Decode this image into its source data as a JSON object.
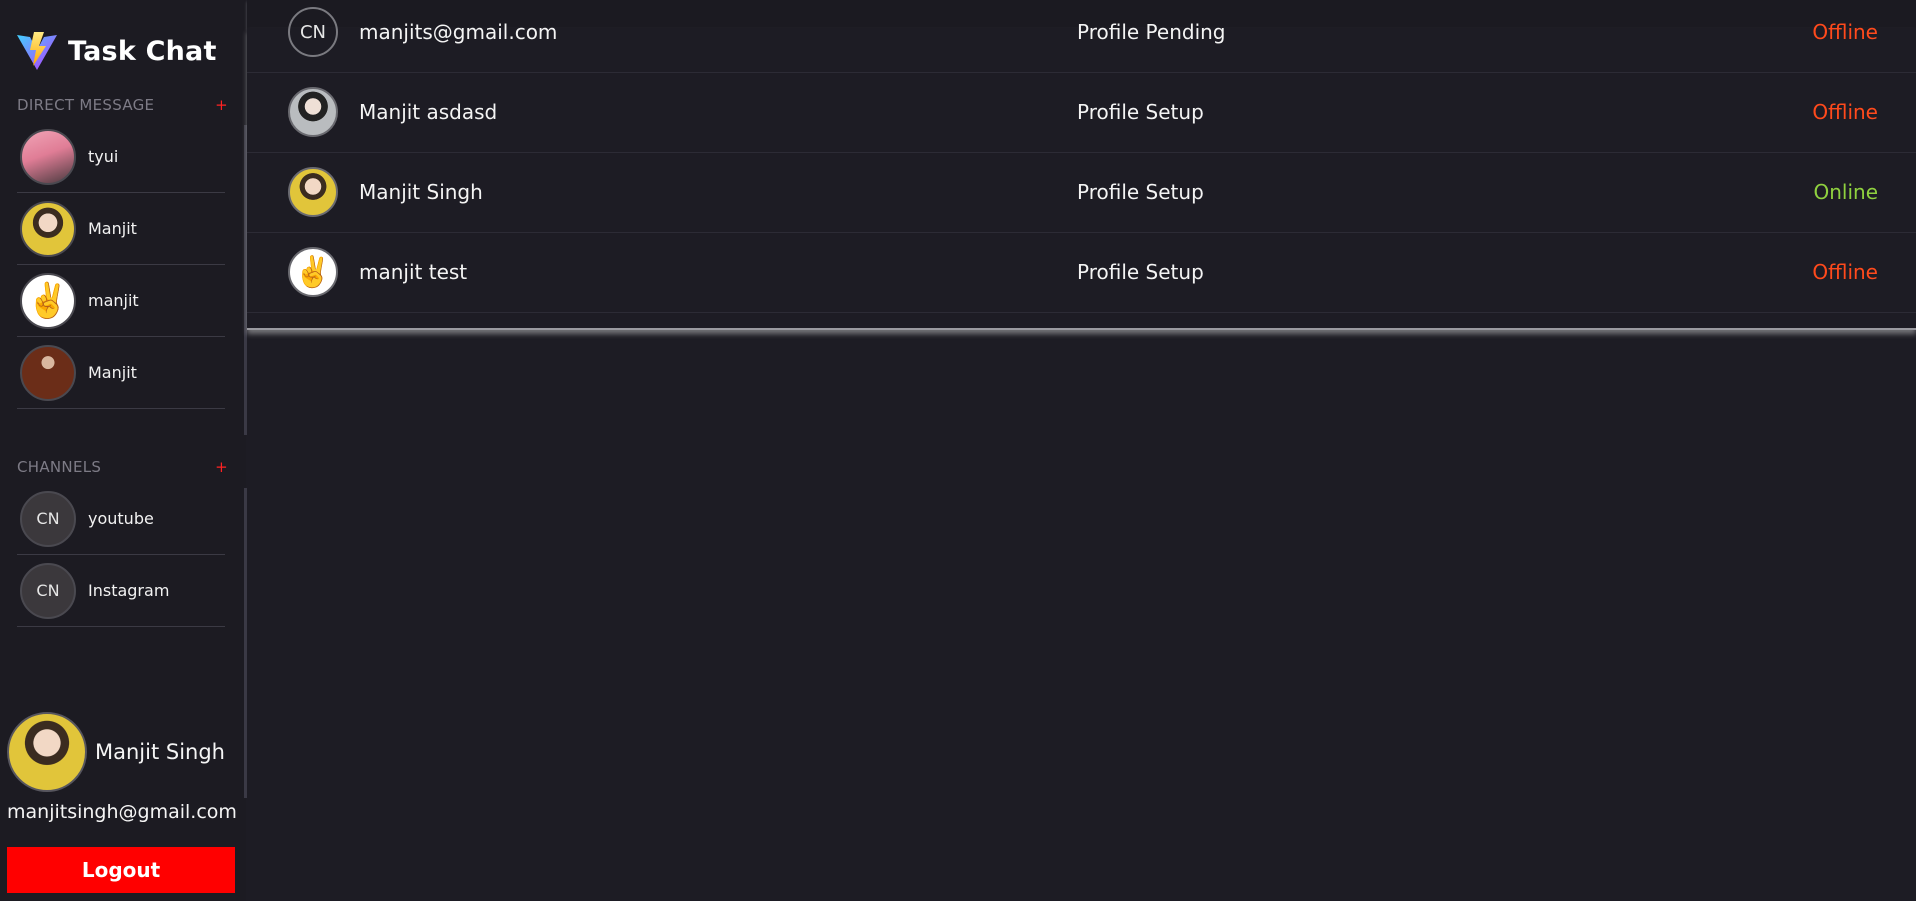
{
  "app": {
    "title": "Task Chat",
    "logo_icon": "vite-lightning-logo"
  },
  "sidebar": {
    "direct_message_heading": "DIRECT MESSAGE",
    "direct_message_add": "+",
    "direct_messages": [
      {
        "label": "tyui",
        "avatar": "photo-pink"
      },
      {
        "label": "Manjit",
        "avatar": "photo-yellow"
      },
      {
        "label": "manjit",
        "avatar": "victory-hand-emoji",
        "emoji": "✌️"
      },
      {
        "label": "Manjit",
        "avatar": "photo-brown"
      }
    ],
    "channels_heading": "CHANNELS",
    "channels_add": "+",
    "channels": [
      {
        "label": "youtube",
        "initials": "CN"
      },
      {
        "label": "Instagram",
        "initials": "CN"
      }
    ],
    "current_user": {
      "name": "Manjit Singh",
      "email": "manjitsingh@gmail.com"
    },
    "logout_label": "Logout"
  },
  "users_table": {
    "rows": [
      {
        "name": "manjits@gmail.com",
        "status": "Profile Pending",
        "presence": "Offline",
        "avatar_initials": "CN"
      },
      {
        "name": "Manjit asdasd",
        "status": "Profile Setup",
        "presence": "Offline",
        "avatar": "photo-gray"
      },
      {
        "name": "Manjit Singh",
        "status": "Profile Setup",
        "presence": "Online",
        "avatar": "photo-yellow"
      },
      {
        "name": "manjit test",
        "status": "Profile Setup",
        "presence": "Offline",
        "avatar": "victory-hand-emoji",
        "emoji": "✌️"
      }
    ]
  },
  "colors": {
    "background": "#1d1c24",
    "offline": "#ff4a1c",
    "online": "#8fd13f",
    "logout": "#ff0000",
    "add_plus": "#ff2222"
  }
}
